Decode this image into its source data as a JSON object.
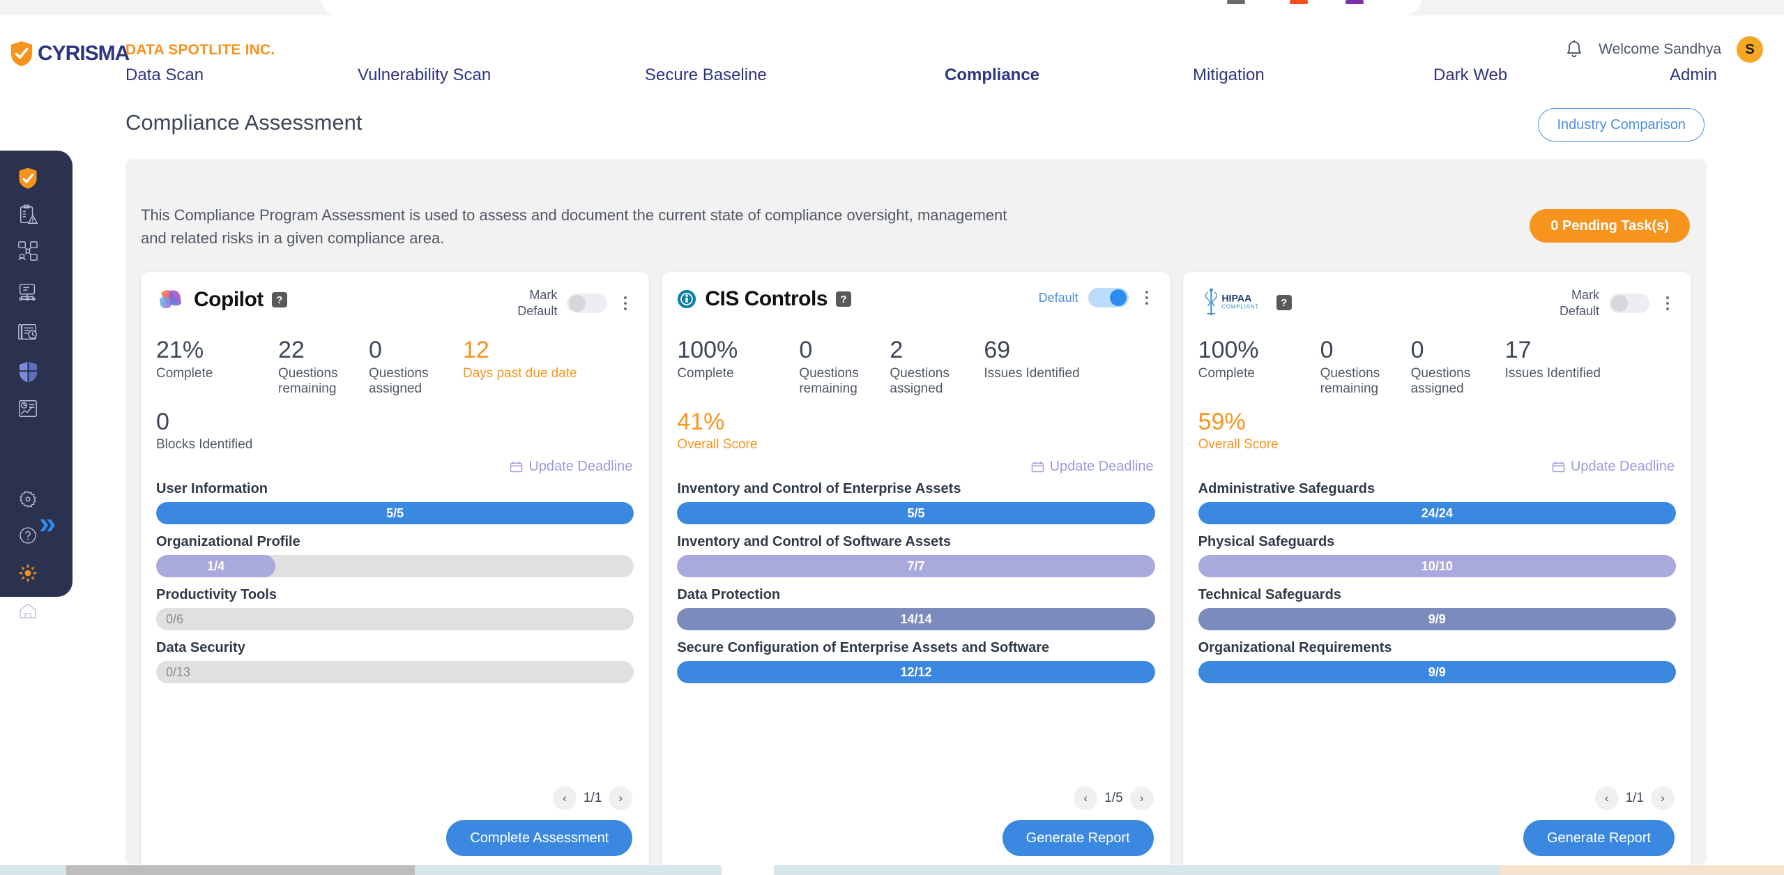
{
  "header": {
    "logo_text": "CYRISMA",
    "org_name": "DATA SPOTLITE INC.",
    "welcome_text": "Welcome Sandhya",
    "avatar_initial": "S",
    "nav_items": [
      {
        "label": "Data Scan",
        "active": false
      },
      {
        "label": "Vulnerability Scan",
        "active": false
      },
      {
        "label": "Secure Baseline",
        "active": false
      },
      {
        "label": "Compliance",
        "active": true
      },
      {
        "label": "Mitigation",
        "active": false
      },
      {
        "label": "Dark Web",
        "active": false
      },
      {
        "label": "Admin",
        "active": false
      }
    ]
  },
  "page": {
    "title": "Compliance Assessment",
    "industry_comparison_label": "Industry Comparison",
    "description": "This Compliance Program Assessment is used to assess and document the current state of compliance oversight, management and related risks in a given compliance area.",
    "pending_tasks_label": "0 Pending Task(s)"
  },
  "sidebar": {
    "items": [
      {
        "icon": "shield-check-icon",
        "label": "Dashboard"
      },
      {
        "icon": "clipboard-alert-icon",
        "label": "Data Scan"
      },
      {
        "icon": "network-users-icon",
        "label": "Vulnerability Scan"
      },
      {
        "icon": "device-network-icon",
        "label": "Secure Baseline"
      },
      {
        "icon": "report-clock-icon",
        "label": "Compliance"
      },
      {
        "icon": "shield-blue-icon",
        "label": "Mitigation"
      },
      {
        "icon": "analytics-chart-icon",
        "label": "Dark Web"
      },
      {
        "icon": "gear-icon",
        "label": "Settings"
      },
      {
        "icon": "help-circle-icon",
        "label": "Help"
      },
      {
        "icon": "sun-burst-icon",
        "label": "Whats New"
      },
      {
        "icon": "home-icon",
        "label": "Home"
      }
    ],
    "expand_label": "»"
  },
  "common": {
    "complete_label": "Complete",
    "questions_remaining_label": "Questions remaining",
    "questions_assigned_label": "Questions assigned",
    "issues_identified_label": "Issues Identified",
    "blocks_identified_label": "Blocks Identified",
    "days_past_due_label": "Days past due date",
    "overall_score_label": "Overall Score",
    "update_deadline_label": "Update Deadline",
    "mark_default_label": "Mark\nDefault",
    "default_label": "Default",
    "help_glyph": "?",
    "prev_glyph": "‹",
    "next_glyph": "›"
  },
  "colors": {
    "brand_navy": "#2d3580",
    "brand_orange": "#f7941e",
    "accent_blue": "#3b88e0",
    "bar_blue": "#3b88e0",
    "bar_lavender": "#a9a9dd",
    "bar_slate": "#7b8bbd",
    "bar_track": "#e0e0e0",
    "rail_bg": "#2b3250",
    "panel_bg": "#f2f2f2"
  },
  "cards": [
    {
      "id": "copilot",
      "logo": "copilot-logo-icon",
      "brand_name": "Copilot",
      "toggle_label": "Mark\nDefault",
      "toggle_on": false,
      "toggle_label_highlight": false,
      "stats": [
        {
          "value": "21%",
          "label": "Complete",
          "warn": false
        },
        {
          "value": "22",
          "label": "Questions remaining",
          "warn": false
        },
        {
          "value": "0",
          "label": "Questions assigned",
          "warn": false
        },
        {
          "value": "12",
          "label": "Days past due date",
          "warn": true
        }
      ],
      "stats_row2": [
        {
          "value": "0",
          "label": "Blocks Identified",
          "warn": false
        }
      ],
      "sections": [
        {
          "label": "User Information",
          "text": "5/5",
          "done": 5,
          "total": 5,
          "color": "#3b88e0"
        },
        {
          "label": "Organizational Profile",
          "text": "1/4",
          "done": 1,
          "total": 4,
          "color": "#a9a9dd"
        },
        {
          "label": "Productivity Tools",
          "text": "0/6",
          "done": 0,
          "total": 6,
          "color": "#7b8bbd"
        },
        {
          "label": "Data Security",
          "text": "0/13",
          "done": 0,
          "total": 13,
          "color": "#3b88e0"
        }
      ],
      "page_indicator": "1/1",
      "action_label": "Complete Assessment"
    },
    {
      "id": "cis-controls",
      "logo": "cis-controls-logo-icon",
      "brand_name": "CIS Controls",
      "toggle_label": "Default",
      "toggle_on": true,
      "toggle_label_highlight": true,
      "stats": [
        {
          "value": "100%",
          "label": "Complete",
          "warn": false
        },
        {
          "value": "0",
          "label": "Questions remaining",
          "warn": false
        },
        {
          "value": "2",
          "label": "Questions assigned",
          "warn": false
        },
        {
          "value": "69",
          "label": "Issues Identified",
          "warn": false
        }
      ],
      "stats_row2": [
        {
          "value": "41%",
          "label": "Overall Score",
          "warn": true
        }
      ],
      "sections": [
        {
          "label": "Inventory and Control of Enterprise Assets",
          "text": "5/5",
          "done": 5,
          "total": 5,
          "color": "#3b88e0"
        },
        {
          "label": "Inventory and Control of Software Assets",
          "text": "7/7",
          "done": 7,
          "total": 7,
          "color": "#a9a9dd"
        },
        {
          "label": "Data Protection",
          "text": "14/14",
          "done": 14,
          "total": 14,
          "color": "#7b8bbd"
        },
        {
          "label": "Secure Configuration of Enterprise Assets and Software",
          "text": "12/12",
          "done": 12,
          "total": 12,
          "color": "#3b88e0"
        }
      ],
      "page_indicator": "1/5",
      "action_label": "Generate Report"
    },
    {
      "id": "hipaa",
      "logo": "hipaa-logo-icon",
      "brand_name": "",
      "toggle_label": "Mark\nDefault",
      "toggle_on": false,
      "toggle_label_highlight": false,
      "stats": [
        {
          "value": "100%",
          "label": "Complete",
          "warn": false
        },
        {
          "value": "0",
          "label": "Questions remaining",
          "warn": false
        },
        {
          "value": "0",
          "label": "Questions assigned",
          "warn": false
        },
        {
          "value": "17",
          "label": "Issues Identified",
          "warn": false
        }
      ],
      "stats_row2": [
        {
          "value": "59%",
          "label": "Overall Score",
          "warn": true
        }
      ],
      "sections": [
        {
          "label": "Administrative Safeguards",
          "text": "24/24",
          "done": 24,
          "total": 24,
          "color": "#3b88e0"
        },
        {
          "label": "Physical Safeguards",
          "text": "10/10",
          "done": 10,
          "total": 10,
          "color": "#a9a9dd"
        },
        {
          "label": "Technical Safeguards",
          "text": "9/9",
          "done": 9,
          "total": 9,
          "color": "#7b8bbd"
        },
        {
          "label": "Organizational Requirements",
          "text": "9/9",
          "done": 9,
          "total": 9,
          "color": "#3b88e0"
        }
      ],
      "page_indicator": "1/1",
      "action_label": "Generate Report"
    }
  ]
}
